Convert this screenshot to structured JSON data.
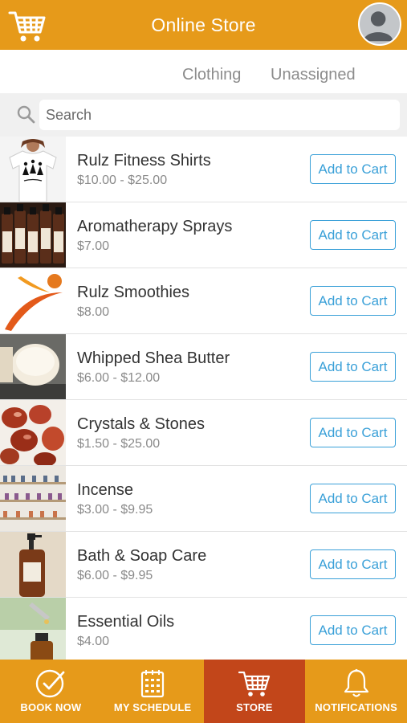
{
  "header": {
    "title": "Online Store",
    "cart_icon": "cart-icon",
    "avatar_icon": "user-avatar-icon"
  },
  "tabs": [
    {
      "label": "Clothing"
    },
    {
      "label": "Unassigned"
    }
  ],
  "search": {
    "placeholder": "Search",
    "icon": "search-icon"
  },
  "products": [
    {
      "name": "Rulz Fitness Shirts",
      "price": "$10.00 - $25.00",
      "button": "Add to Cart",
      "thumb": "t-shirt"
    },
    {
      "name": "Aromatherapy Sprays",
      "price": "$7.00",
      "button": "Add to Cart",
      "thumb": "spray-bottles"
    },
    {
      "name": "Rulz Smoothies",
      "price": "$8.00",
      "button": "Add to Cart",
      "thumb": "swoosh-logo"
    },
    {
      "name": "Whipped Shea Butter",
      "price": "$6.00 - $12.00",
      "button": "Add to Cart",
      "thumb": "butter-jar"
    },
    {
      "name": "Crystals & Stones",
      "price": "$1.50 - $25.00",
      "button": "Add to Cart",
      "thumb": "red-stones"
    },
    {
      "name": "Incense",
      "price": "$3.00 - $9.95",
      "button": "Add to Cart",
      "thumb": "incense-shelf"
    },
    {
      "name": "Bath & Soap Care",
      "price": "$6.00 - $9.95",
      "button": "Add to Cart",
      "thumb": "soap-bottle"
    },
    {
      "name": "Essential Oils",
      "price": "$4.00",
      "button": "Add to Cart",
      "thumb": "dropper-bottle"
    }
  ],
  "bottom_nav": [
    {
      "label": "BOOK NOW",
      "icon": "check-circle-icon",
      "active": false
    },
    {
      "label": "MY SCHEDULE",
      "icon": "calendar-icon",
      "active": false
    },
    {
      "label": "STORE",
      "icon": "cart-icon",
      "active": true
    },
    {
      "label": "NOTIFICATIONS",
      "icon": "bell-icon",
      "active": false
    }
  ],
  "colors": {
    "header_bg": "#e69a1a",
    "nav_active_bg": "#c2461a",
    "button_accent": "#3aa0d8"
  }
}
